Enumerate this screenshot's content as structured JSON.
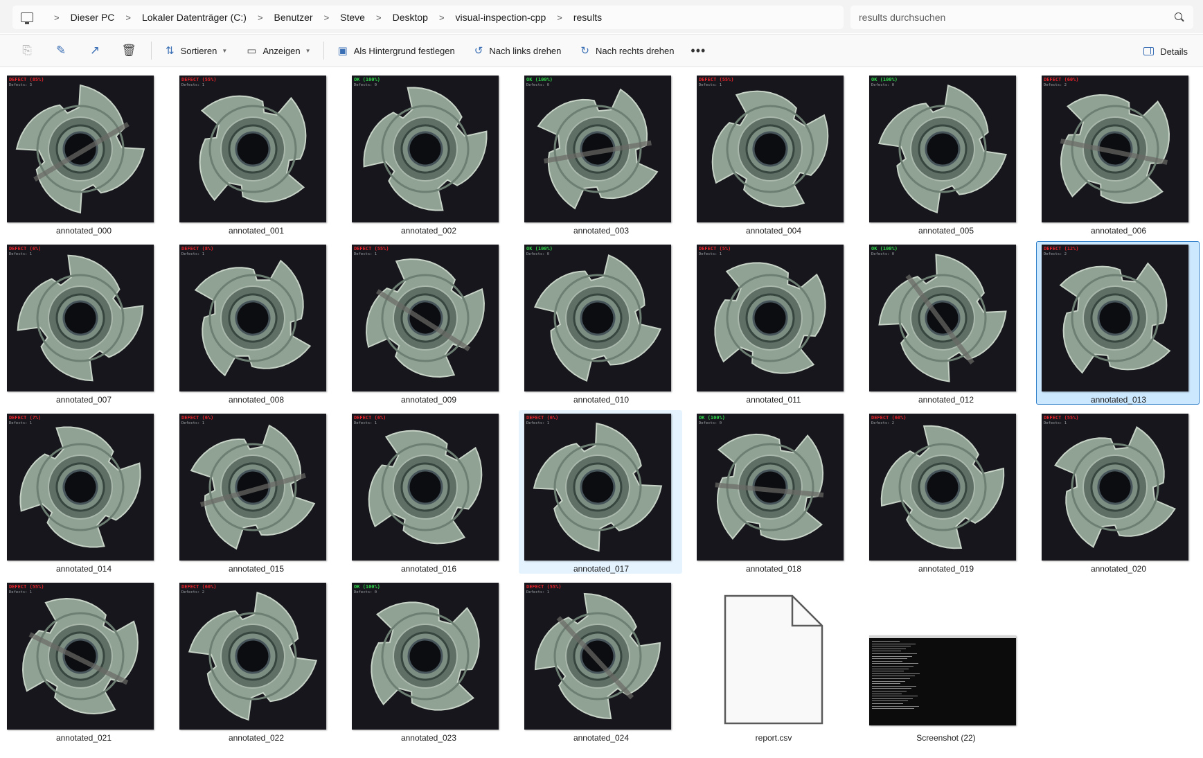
{
  "address_bar": {
    "breadcrumb": [
      "Dieser PC",
      "Lokaler Datenträger (C:)",
      "Benutzer",
      "Steve",
      "Desktop",
      "visual-inspection-cpp",
      "results"
    ],
    "search_placeholder": "results durchsuchen",
    "pc_icon": "computer-icon"
  },
  "command_bar": {
    "icons": [
      "copy-icon",
      "rename-icon",
      "share-icon",
      "delete-icon"
    ],
    "sort_label": "Sortieren",
    "view_label": "Anzeigen",
    "set_background_label": "Als Hintergrund festlegen",
    "rotate_left_label": "Nach links drehen",
    "rotate_right_label": "Nach rechts drehen",
    "more_label": "•••",
    "details_label": "Details"
  },
  "files": [
    {
      "name": "annotated_000",
      "type": "image",
      "status": "DEFECT (85%)",
      "ok": false,
      "defects": "Defects: 3"
    },
    {
      "name": "annotated_001",
      "type": "image",
      "status": "DEFECT (55%)",
      "ok": false,
      "defects": "Defects: 1"
    },
    {
      "name": "annotated_002",
      "type": "image",
      "status": "OK (100%)",
      "ok": true,
      "defects": "Defects: 0"
    },
    {
      "name": "annotated_003",
      "type": "image",
      "status": "OK (100%)",
      "ok": true,
      "defects": "Defects: 0"
    },
    {
      "name": "annotated_004",
      "type": "image",
      "status": "DEFECT (55%)",
      "ok": false,
      "defects": "Defects: 1"
    },
    {
      "name": "annotated_005",
      "type": "image",
      "status": "OK (100%)",
      "ok": true,
      "defects": "Defects: 0"
    },
    {
      "name": "annotated_006",
      "type": "image",
      "status": "DEFECT (60%)",
      "ok": false,
      "defects": "Defects: 2"
    },
    {
      "name": "annotated_007",
      "type": "image",
      "status": "DEFECT (6%)",
      "ok": false,
      "defects": "Defects: 1"
    },
    {
      "name": "annotated_008",
      "type": "image",
      "status": "DEFECT (8%)",
      "ok": false,
      "defects": "Defects: 1"
    },
    {
      "name": "annotated_009",
      "type": "image",
      "status": "DEFECT (55%)",
      "ok": false,
      "defects": "Defects: 1"
    },
    {
      "name": "annotated_010",
      "type": "image",
      "status": "OK (100%)",
      "ok": true,
      "defects": "Defects: 0"
    },
    {
      "name": "annotated_011",
      "type": "image",
      "status": "DEFECT (5%)",
      "ok": false,
      "defects": "Defects: 1"
    },
    {
      "name": "annotated_012",
      "type": "image",
      "status": "OK (100%)",
      "ok": true,
      "defects": "Defects: 0"
    },
    {
      "name": "annotated_013",
      "type": "image",
      "status": "DEFECT (12%)",
      "ok": false,
      "defects": "Defects: 2",
      "state": "selected"
    },
    {
      "name": "annotated_014",
      "type": "image",
      "status": "DEFECT (7%)",
      "ok": false,
      "defects": "Defects: 1"
    },
    {
      "name": "annotated_015",
      "type": "image",
      "status": "DEFECT (6%)",
      "ok": false,
      "defects": "Defects: 1"
    },
    {
      "name": "annotated_016",
      "type": "image",
      "status": "DEFECT (6%)",
      "ok": false,
      "defects": "Defects: 1"
    },
    {
      "name": "annotated_017",
      "type": "image",
      "status": "DEFECT (6%)",
      "ok": false,
      "defects": "Defects: 1",
      "state": "hover"
    },
    {
      "name": "annotated_018",
      "type": "image",
      "status": "OK (100%)",
      "ok": true,
      "defects": "Defects: 0"
    },
    {
      "name": "annotated_019",
      "type": "image",
      "status": "DEFECT (60%)",
      "ok": false,
      "defects": "Defects: 2"
    },
    {
      "name": "annotated_020",
      "type": "image",
      "status": "DEFECT (55%)",
      "ok": false,
      "defects": "Defects: 1"
    },
    {
      "name": "annotated_021",
      "type": "image",
      "status": "DEFECT (55%)",
      "ok": false,
      "defects": "Defects: 1"
    },
    {
      "name": "annotated_022",
      "type": "image",
      "status": "DEFECT (60%)",
      "ok": false,
      "defects": "Defects: 2"
    },
    {
      "name": "annotated_023",
      "type": "image",
      "status": "OK (100%)",
      "ok": true,
      "defects": "Defects: 0"
    },
    {
      "name": "annotated_024",
      "type": "image",
      "status": "DEFECT (55%)",
      "ok": false,
      "defects": "Defects: 1"
    },
    {
      "name": "report.csv",
      "type": "document"
    },
    {
      "name": "Screenshot (22)",
      "type": "screenshot"
    }
  ],
  "colors": {
    "accent": "#3a6fb5",
    "selected_bg": "#cce8ff",
    "selected_border": "#2f7fc9",
    "hover_bg": "#e5f3ff",
    "defect_text": "#e5232a",
    "ok_text": "#2fd84a"
  }
}
